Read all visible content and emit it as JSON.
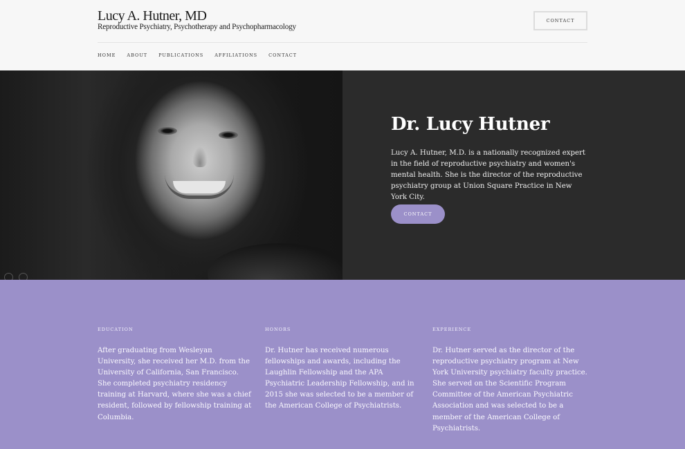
{
  "header": {
    "title": "Lucy A. Hutner, MD",
    "subtitle": "Reproductive Psychiatry, Psychotherapy and Psychopharmacology",
    "contact_label": "CONTACT",
    "nav": [
      {
        "label": "HOME"
      },
      {
        "label": "ABOUT"
      },
      {
        "label": "PUBLICATIONS"
      },
      {
        "label": "AFFILIATIONS"
      },
      {
        "label": "CONTACT"
      }
    ]
  },
  "hero": {
    "title": "Dr. Lucy Hutner",
    "text": "Lucy A. Hutner, M.D. is a nationally recognized expert in the field of reproductive psychiatry and women's mental health. She is the director of the reproductive psychiatry group at Union Square Practice in New York City.",
    "contact_label": "CONTACT"
  },
  "info": {
    "columns": [
      {
        "heading": "EDUCATION",
        "text": "After graduating from Wesleyan University, she received her M.D. from the University of California, San Francisco. She completed psychiatry residency training at Harvard, where she was a chief resident, followed by fellowship training at Columbia."
      },
      {
        "heading": "HONORS",
        "text": "Dr. Hutner has received numerous fellowships and awards, including the Laughlin Fellowship and the APA Psychiatric Leadership Fellowship, and in 2015 she was selected to be a member of the American College of Psychiatrists."
      },
      {
        "heading": "EXPERIENCE",
        "text": "Dr. Hutner served as the director of the reproductive psychiatry program at New York University psychiatry faculty practice. She served on the Scientific Program Committee of the American Psychiatric Association and was selected to be a member of the American College of Psychiatrists."
      }
    ]
  },
  "colors": {
    "accent": "#9b90c9",
    "hero_background": "#2b2b2b",
    "header_background": "#f7f7f7"
  }
}
